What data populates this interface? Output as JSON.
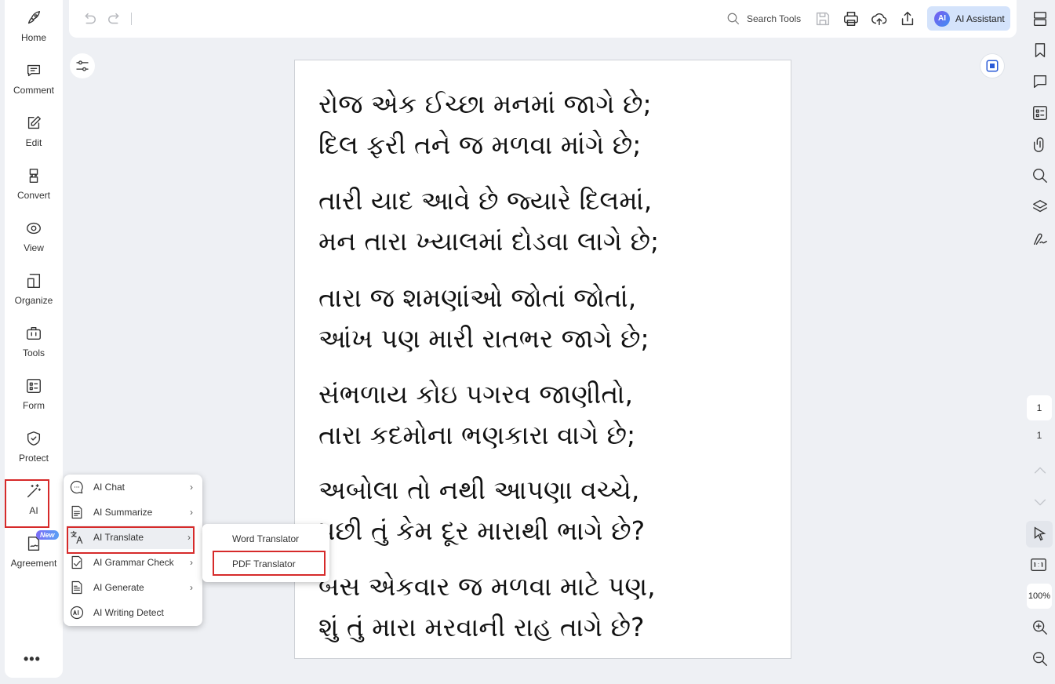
{
  "sidebar": {
    "items": [
      {
        "label": "Home",
        "icon": "rocket-icon"
      },
      {
        "label": "Comment",
        "icon": "comment-icon"
      },
      {
        "label": "Edit",
        "icon": "edit-icon"
      },
      {
        "label": "Convert",
        "icon": "convert-icon"
      },
      {
        "label": "View",
        "icon": "view-icon"
      },
      {
        "label": "Organize",
        "icon": "organize-icon"
      },
      {
        "label": "Tools",
        "icon": "toolbox-icon"
      },
      {
        "label": "Form",
        "icon": "form-icon"
      },
      {
        "label": "Protect",
        "icon": "shield-icon"
      },
      {
        "label": "AI",
        "icon": "magic-wand-icon"
      },
      {
        "label": "Agreement",
        "icon": "agreement-icon",
        "badge": "New"
      }
    ],
    "more": "•••"
  },
  "toolbar": {
    "search_label": "Search Tools",
    "ai_logo": "AI",
    "ai_assistant_label": "AI Assistant"
  },
  "document": {
    "stanzas": [
      [
        "રોજ એક ઈચ્છા મનમાં જાગે છે;",
        "દિલ ફરી તને જ મળવા માંગે છે;"
      ],
      [
        "તારી યાદ આવે છે જ્યારે દિલમાં,",
        "મન તારા ખ્યાલમાં દોડવા લાગે છે;"
      ],
      [
        "તારા જ શમણાંઓ જોતાં જોતાં,",
        "આંખ પણ મારી રાતભર જાગે છે;"
      ],
      [
        "સંભળાય કોઇ પગરવ જાણીતો,",
        "તારા કદમોના ભણકારા વાગે છે;"
      ],
      [
        "અબોલા તો નથી આપણા વચ્ચે,",
        "પછી તું કેમ દૂર મારાથી ભાગે છે?"
      ],
      [
        "બસ એકવાર જ મળવા માટે પણ,",
        "શું તું મારા મરવાની રાહ તાગે છે?"
      ]
    ]
  },
  "ai_menu": {
    "items": [
      {
        "label": "AI Chat",
        "icon": "ai-chat-icon"
      },
      {
        "label": "AI Summarize",
        "icon": "ai-summarize-icon"
      },
      {
        "label": "AI Translate",
        "icon": "ai-translate-icon"
      },
      {
        "label": "AI Grammar Check",
        "icon": "ai-grammar-icon"
      },
      {
        "label": "AI Generate",
        "icon": "ai-generate-icon"
      },
      {
        "label": "AI Writing Detect",
        "icon": "ai-detect-icon"
      }
    ],
    "arrow": "›"
  },
  "translate_submenu": {
    "items": [
      "Word Translator",
      "PDF Translator"
    ]
  },
  "page_nav": {
    "current_page": "1",
    "total_pages": "1",
    "zoom": "100%"
  }
}
